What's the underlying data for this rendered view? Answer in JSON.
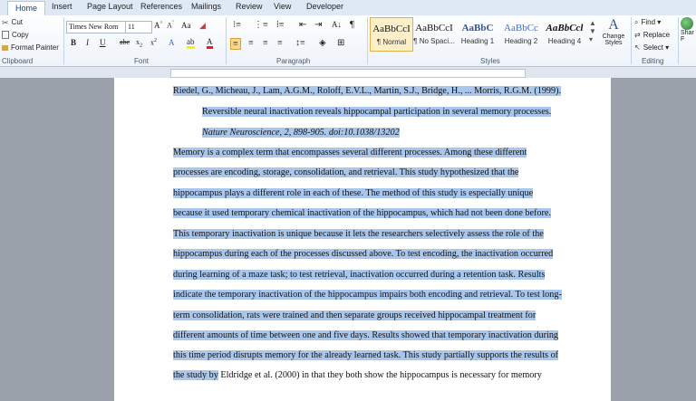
{
  "tabs": [
    "Home",
    "Insert",
    "Page Layout",
    "References",
    "Mailings",
    "Review",
    "View",
    "Developer"
  ],
  "clipboard": {
    "cut": "Cut",
    "copy": "Copy",
    "format_painter": "Format Painter",
    "group": "Clipboard"
  },
  "font": {
    "name": "Times New Rom",
    "size": "11",
    "group": "Font"
  },
  "paragraph": {
    "group": "Paragraph"
  },
  "styles": {
    "group": "Styles",
    "items": [
      {
        "preview": "AaBbCcI",
        "label": "¶ Normal"
      },
      {
        "preview": "AaBbCcI",
        "label": "¶ No Spaci..."
      },
      {
        "preview": "AaBbC",
        "label": "Heading 1"
      },
      {
        "preview": "AaBbCc",
        "label": "Heading 2"
      },
      {
        "preview": "AaBbCcl",
        "label": "Heading 4"
      }
    ],
    "change_styles": "Change Styles"
  },
  "editing": {
    "find": "Find",
    "replace": "Replace",
    "select": "Select",
    "group": "Editing"
  },
  "share": {
    "label": "Shar This F"
  },
  "document": {
    "lines": [
      "Riedel, G., Micheau, J., Lam, A.G.M., Roloff, E.V.L., Martin, S.J., Bridge, H., ... Morris, R.G.M. (1999).",
      "Reversible neural inactivation reveals hippocampal participation in several memory processes.",
      "Nature Neuroscience, 2, 898-905. doi:10.1038/13202",
      "Memory is a complex term that encompasses several different processes.  Among these different",
      "processes are encoding, storage, consolidation, and retrieval.  This study hypothesized that the",
      "hippocampus plays a different role in each of these.  The method of this study is especially unique",
      "because it used temporary chemical inactivation of the hippocampus, which had not been done before.",
      "This temporary inactivation is unique because it lets the researchers selectively assess the role of the",
      "hippocampus during each of the processes discussed above.  To test encoding, the inactivation occurred",
      "during learning of a maze task; to test retrieval, inactivation occurred during a retention task.  Results",
      "indicate the temporary inactivation of the hippocampus impairs both encoding and retrieval.  To test long-",
      "term consolidation, rats were trained and then separate groups received hippocampal treatment for",
      "different amounts of time between one and five days.  Results showed that temporary inactivation during",
      "this time period disrupts memory for the already learned task.  This study partially supports the results of",
      "the study by",
      " Eldridge et al. (2000) in that they both show the hippocampus is necessary for memory"
    ]
  }
}
